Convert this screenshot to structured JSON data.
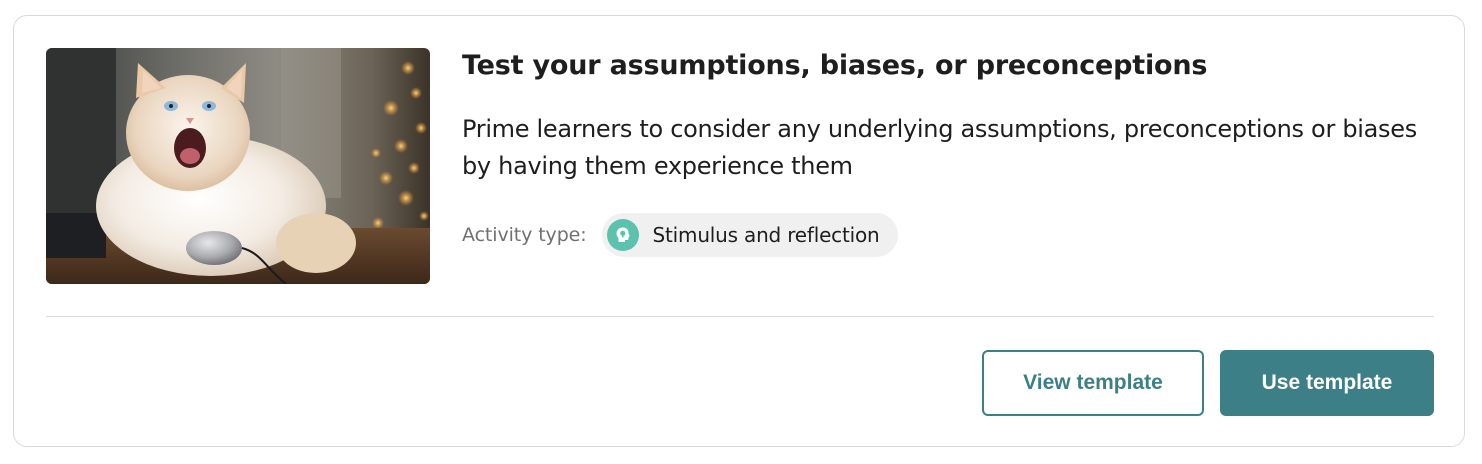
{
  "card": {
    "title": "Test your assumptions, biases, or preconceptions",
    "description": "Prime learners to consider any underlying assumptions, preconceptions or biases by having them experience them",
    "activity_type_label": "Activity type:",
    "activity_type_value": "Stimulus and reflection",
    "activity_icon": "head-lightbulb-icon",
    "thumbnail_subject": "fluffy white cat with open mouth next to a computer mouse"
  },
  "actions": {
    "view_label": "View template",
    "use_label": "Use template"
  },
  "colors": {
    "accent": "#3d7f87",
    "activity_icon_bg": "#5cc1ad",
    "pill_bg": "#f0f0f0",
    "border": "#d9d9d9",
    "text": "#1e1e1e",
    "muted_text": "#707070"
  }
}
